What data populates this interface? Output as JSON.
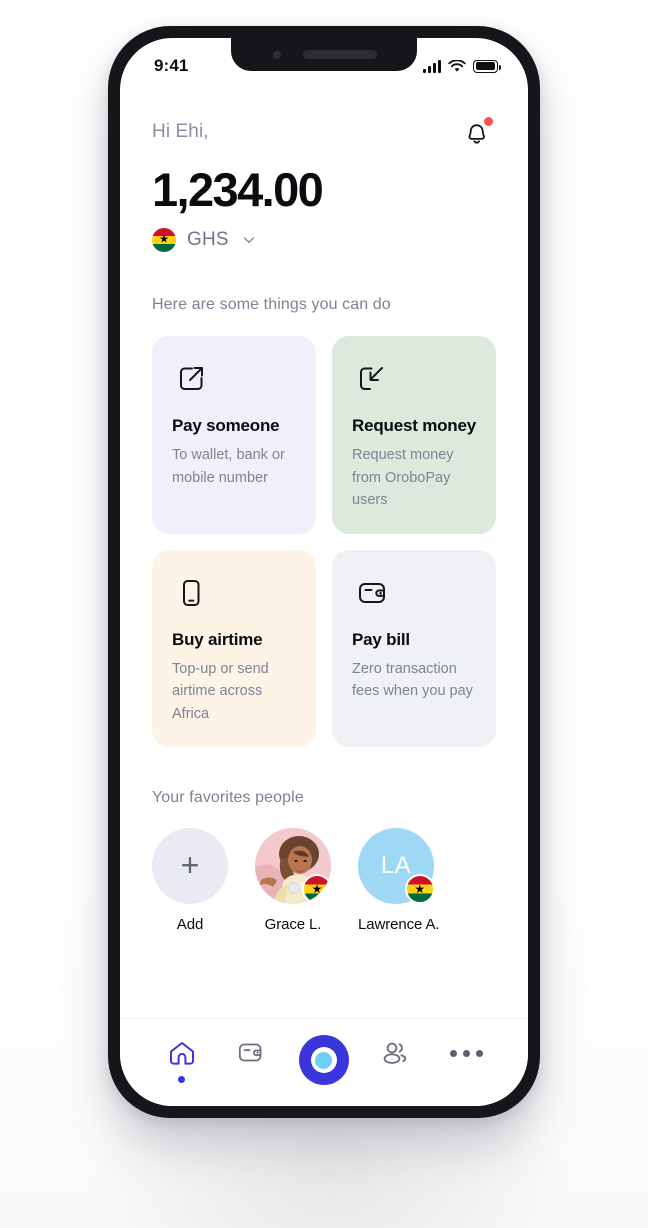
{
  "status_bar": {
    "time": "9:41",
    "signal_icon": "cellular-signal-icon",
    "wifi_icon": "wifi-icon",
    "battery_icon": "battery-icon"
  },
  "header": {
    "greeting": "Hi Ehi,",
    "balance": "1,234.00",
    "currency_code": "GHS",
    "currency_flag": "ghana-flag",
    "notification_icon": "bell-icon",
    "has_notification_badge": true,
    "chevron_icon": "chevron-down-icon"
  },
  "actions": {
    "section_label": "Here are some things you can do",
    "cards": [
      {
        "title": "Pay someone",
        "desc": "To wallet, bank or mobile number",
        "icon": "send-arrow-out-icon",
        "bg": "#F1F0FA"
      },
      {
        "title": "Request money",
        "desc": "Request money from OroboPay users",
        "icon": "receive-arrow-in-icon",
        "bg": "#DCE9DC"
      },
      {
        "title": "Buy airtime",
        "desc": "Top-up or send airtime across Africa",
        "icon": "mobile-phone-icon",
        "bg": "#FDF4E7"
      },
      {
        "title": "Pay bill",
        "desc": "Zero transaction fees when you pay",
        "icon": "wallet-icon",
        "bg": "#EFF1F4"
      }
    ]
  },
  "favorites": {
    "section_label": "Your favorites people",
    "items": [
      {
        "name": "Add",
        "type": "add-button",
        "icon": "plus-icon"
      },
      {
        "name": "Grace L.",
        "type": "photo",
        "flag": "ghana-flag"
      },
      {
        "name": "Lawrence A.",
        "type": "initials",
        "initials": "LA",
        "flag": "ghana-flag"
      }
    ]
  },
  "bottom_nav": {
    "items": [
      {
        "icon": "home-icon",
        "active": true
      },
      {
        "icon": "wallet-icon",
        "active": false
      },
      {
        "icon": "scan-circle-icon",
        "active": false
      },
      {
        "icon": "people-icon",
        "active": false
      },
      {
        "icon": "more-dots-icon",
        "active": false
      }
    ]
  },
  "colors": {
    "accent": "#3A36DB",
    "accent_light": "#6DCFF6",
    "notification": "#F8524F",
    "text_primary": "#0A0C10",
    "text_muted": "#7C8293"
  }
}
